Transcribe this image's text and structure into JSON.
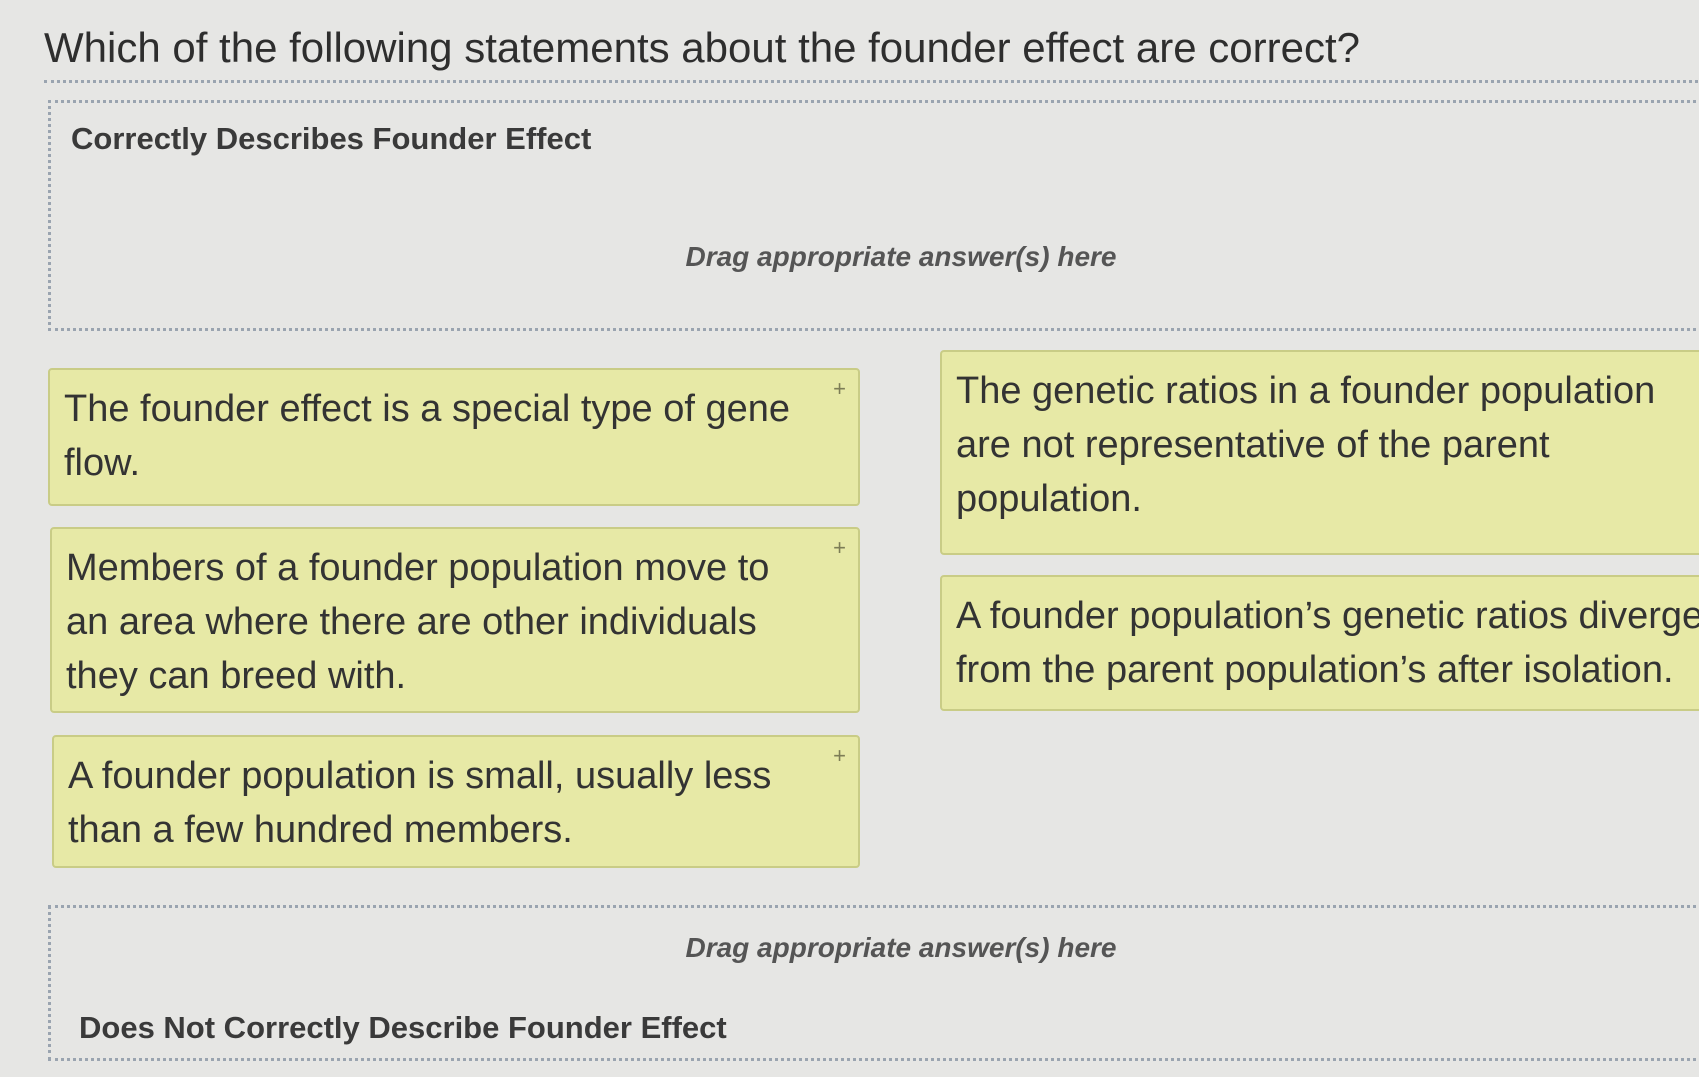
{
  "question": "Which of the following statements about the founder effect are correct?",
  "zones": {
    "correct": {
      "title": "Correctly Describes Founder Effect",
      "hint": "Drag appropriate answer(s) here"
    },
    "incorrect": {
      "title": "Does Not Correctly Describe Founder Effect",
      "hint": "Drag appropriate answer(s) here"
    }
  },
  "cards": [
    {
      "text": "The founder effect is a special type of gene flow.",
      "icon": "move-handle-icon",
      "handle": "+"
    },
    {
      "text": "Members of a founder population move to an area where there are other individuals they can breed with.",
      "icon": "move-handle-icon",
      "handle": "+"
    },
    {
      "text": "A founder population is small, usually less than a few hundred members.",
      "icon": "move-handle-icon",
      "handle": "+"
    },
    {
      "text": "The genetic ratios in a founder population are not representative of the parent population."
    },
    {
      "text": "A founder population’s genetic ratios diverge from the parent population’s after isolation."
    }
  ],
  "colors": {
    "card_bg": "#e7e9a6",
    "card_border": "#c9cc86",
    "zone_border": "#9aa4b0",
    "page_bg": "#e6e6e4"
  }
}
